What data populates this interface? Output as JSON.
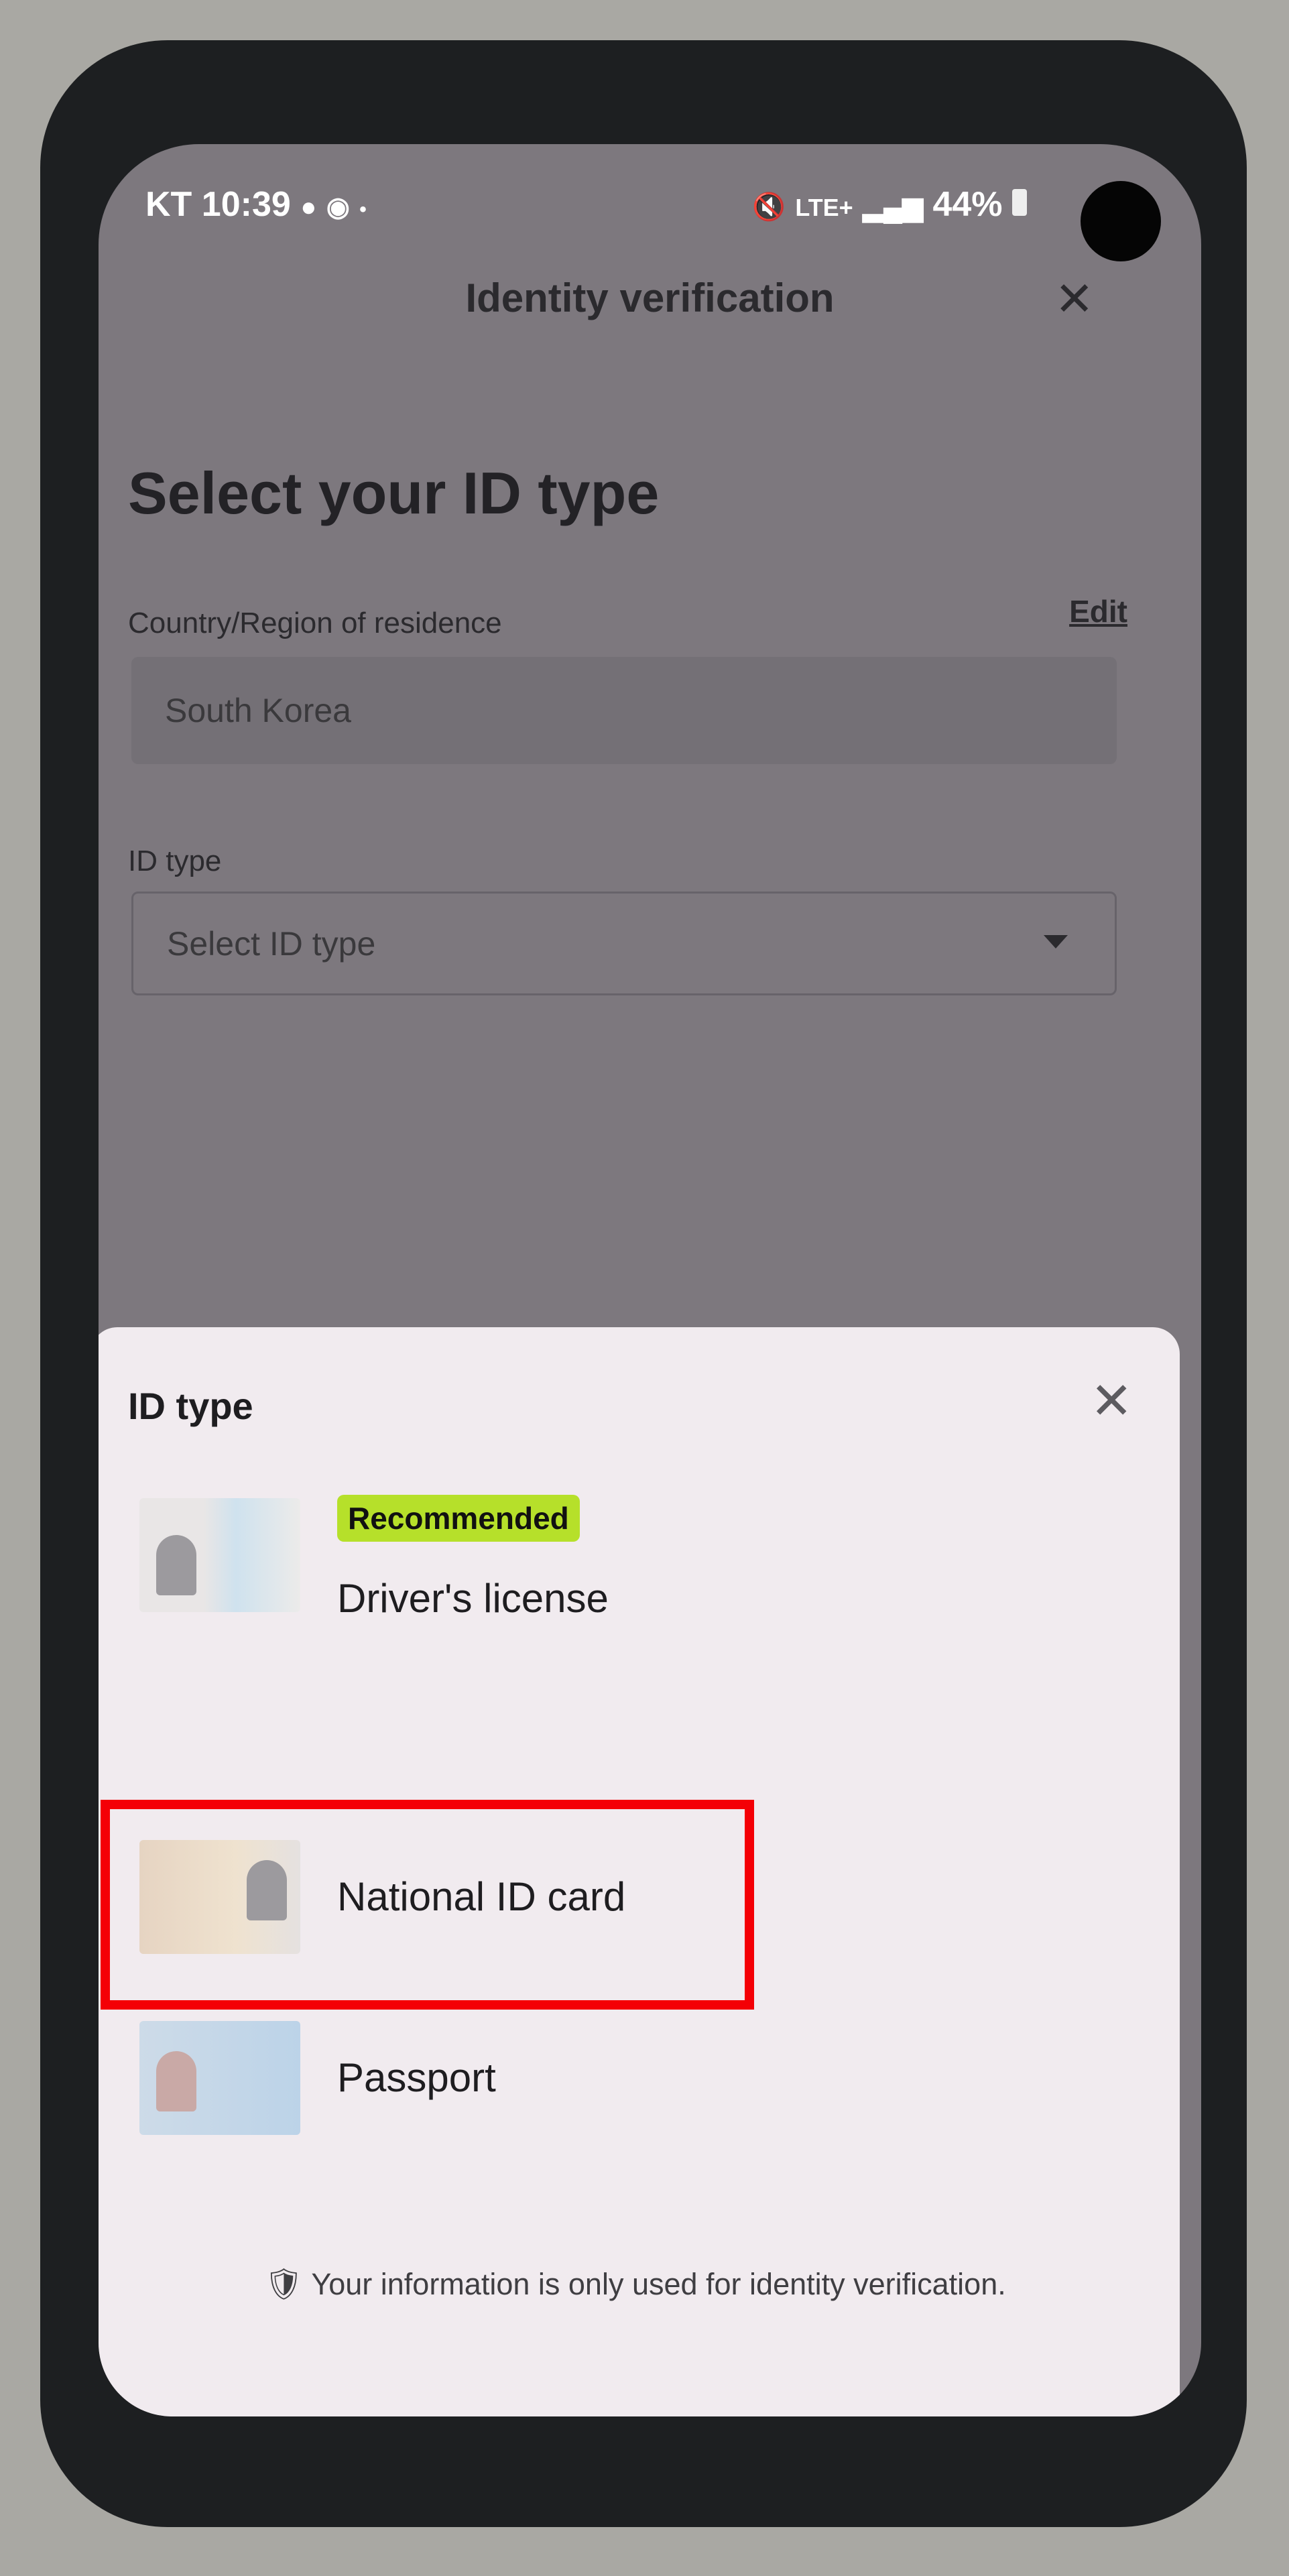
{
  "status_bar": {
    "carrier": "KT",
    "time": "10:39",
    "battery": "44%",
    "network": "LTE+",
    "icons": [
      "talk-icon",
      "notification-icon",
      "location-icon",
      "dot-icon",
      "mute-icon",
      "hd-icon",
      "signal-icon",
      "battery-icon"
    ]
  },
  "header": {
    "title": "Identity verification",
    "close_icon": "close-icon"
  },
  "page": {
    "heading": "Select your ID type",
    "country_label": "Country/Region of residence",
    "edit_label": "Edit",
    "country_value": "South Korea",
    "id_type_label": "ID type",
    "id_type_placeholder": "Select ID type"
  },
  "sheet": {
    "title": "ID type",
    "options": [
      {
        "label": "Driver's license",
        "badge": "Recommended"
      },
      {
        "label": "National ID card",
        "highlighted": true
      },
      {
        "label": "Passport"
      }
    ],
    "note": "Your information is only used for identity verification."
  },
  "colors": {
    "badge": "#b6e02a",
    "highlight": "#f40006",
    "overlay": "#7d787e",
    "sheet": "#f1ebef"
  },
  "nav_bar": {
    "icons": [
      "recent-apps-icon",
      "home-icon",
      "back-icon"
    ]
  }
}
